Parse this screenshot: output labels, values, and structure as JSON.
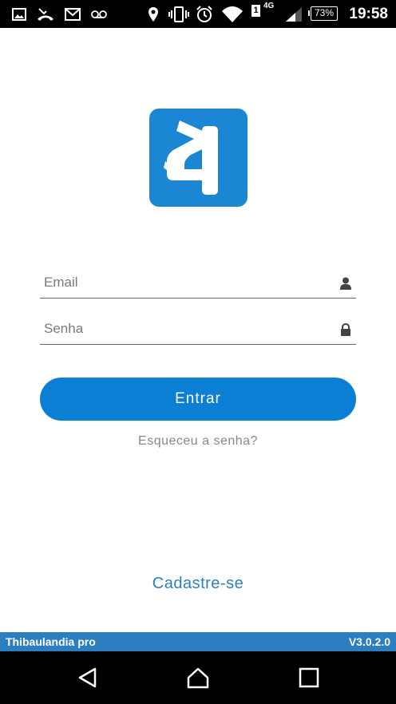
{
  "status_bar": {
    "time": "19:58",
    "battery": "73%",
    "network": "4G",
    "sim": "1",
    "icons": [
      "gallery-icon",
      "missed-call-icon",
      "gmail-icon",
      "voicemail-icon",
      "location-icon",
      "vibrate-icon",
      "alarm-icon",
      "wifi-icon",
      "signal-icon",
      "battery-icon"
    ]
  },
  "login": {
    "email_placeholder": "Email",
    "password_placeholder": "Senha",
    "submit_label": "Entrar",
    "forgot_label": "Esqueceu a senha?",
    "signup_label": "Cadastre-se"
  },
  "footer": {
    "app_name": "Thibaulandia pro",
    "version": "V3.0.2.0"
  },
  "colors": {
    "brand_blue": "#1b86d4",
    "button_blue": "#0a7fd4",
    "footer_blue": "#2c7ec1"
  },
  "nav": {
    "icons": [
      "back-icon",
      "home-icon",
      "recents-icon"
    ]
  }
}
